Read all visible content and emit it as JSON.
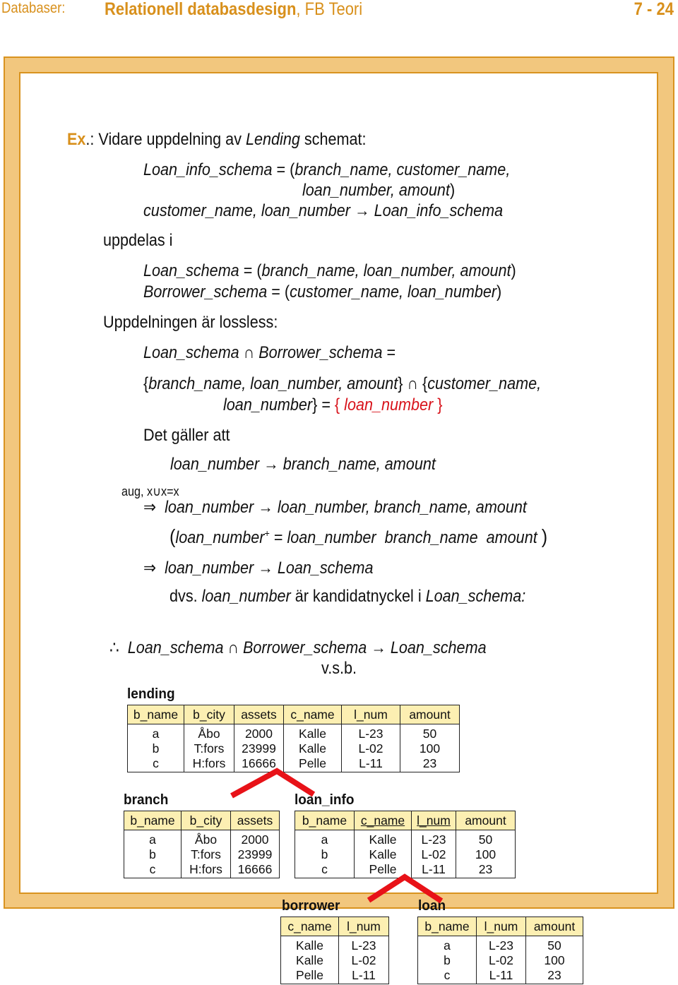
{
  "header": {
    "course": "Databaser:",
    "title_bold": "Relationell databasdesign",
    "title_rest": ", FB Teori",
    "page": "7 - 24"
  },
  "colors": {
    "accent": "#d8901c",
    "frame_fill": "#f2c77e",
    "highlight_red": "#d8131b",
    "table_header": "#fcefb2"
  },
  "content": {
    "ex_label": "Ex",
    "ex_rest_pre": ".: Vidare uppdelning av ",
    "ex_rest_it": "Lending",
    "ex_rest_post": " schemat:",
    "line1a": "Loan_info_schema",
    "line1b": " = (",
    "line1c": "branch_name, customer_name,",
    "line2": "loan_number, amount",
    "line2_close": ")",
    "line3a": "customer_name, loan_number",
    "arrow": "→",
    "line3b": "Loan_info_schema",
    "uppdelas": "uppdelas i",
    "loan_schema_a": "Loan_schema",
    "loan_schema_b": " = (",
    "loan_schema_c": "branch_name, loan_number, amount",
    "close_paren": ")",
    "borrower_schema_a": "Borrower_schema",
    "borrower_schema_b": " = (",
    "borrower_schema_c": "customer_name, loan_number",
    "lossless": "Uppdelningen är lossless:",
    "inter_a": "Loan_schema",
    "cap": "∩",
    "inter_b": "Borrower_schema",
    "equals": " =",
    "set1_open": "{",
    "set1": "branch_name, loan_number, amount",
    "set1_close": "}",
    "set2_open": "{",
    "set2": "customer_name,",
    "set2b": "loan_number",
    "set2_close": "} = ",
    "result_open": "{ ",
    "result": "loan_number",
    "result_close": " }",
    "det_galler": "Det gäller att",
    "fd1a": "loan_number",
    "fd1b": "branch_name, amount",
    "aug": "aug, x∪x=x",
    "implies": "⇒",
    "fd2a": "loan_number",
    "fd2b": "loan_number, branch_name, amount",
    "paren_open": "(",
    "closure_a": "loan_number",
    "closure_sup": "+",
    "closure_b": " = ",
    "closure_c": "loan_number  branch_name  amount",
    "paren_close": ")",
    "fd3a": "loan_number",
    "fd3b": "Loan_schema",
    "dvs_pre": "dvs. ",
    "dvs_it": "loan_number",
    "dvs_mid": " är kandidatnyckel i ",
    "dvs_it2": "Loan_schema:",
    "therefore": "∴",
    "concl_a": "Loan_schema",
    "concl_b": "Borrower_schema",
    "concl_c": "Loan_schema",
    "vsb": "v.s.b."
  },
  "tables": {
    "lending": {
      "name": "lending",
      "columns": [
        "b_name",
        "b_city",
        "assets",
        "c_name",
        "l_num",
        "amount"
      ],
      "rows": [
        [
          "a",
          "Åbo",
          "2000",
          "Kalle",
          "L-23",
          "50"
        ],
        [
          "b",
          "T:fors",
          "23999",
          "Kalle",
          "L-02",
          "100"
        ],
        [
          "c",
          "H:fors",
          "16666",
          "Pelle",
          "L-11",
          "23"
        ]
      ]
    },
    "branch": {
      "name": "branch",
      "columns": [
        "b_name",
        "b_city",
        "assets"
      ],
      "rows": [
        [
          "a",
          "Åbo",
          "2000"
        ],
        [
          "b",
          "T:fors",
          "23999"
        ],
        [
          "c",
          "H:fors",
          "16666"
        ]
      ]
    },
    "loan_info": {
      "name": "loan_info",
      "columns": [
        "b_name",
        "c_name",
        "l_num",
        "amount"
      ],
      "underlined_columns": [
        "c_name",
        "l_num"
      ],
      "rows": [
        [
          "a",
          "Kalle",
          "L-23",
          "50"
        ],
        [
          "b",
          "Kalle",
          "L-02",
          "100"
        ],
        [
          "c",
          "Pelle",
          "L-11",
          "23"
        ]
      ]
    },
    "borrower": {
      "name": "borrower",
      "columns": [
        "c_name",
        "l_num"
      ],
      "rows": [
        [
          "Kalle",
          "L-23"
        ],
        [
          "Kalle",
          "L-02"
        ],
        [
          "Pelle",
          "L-11"
        ]
      ]
    },
    "loan": {
      "name": "loan",
      "columns": [
        "b_name",
        "l_num",
        "amount"
      ],
      "rows": [
        [
          "a",
          "L-23",
          "50"
        ],
        [
          "b",
          "L-02",
          "100"
        ],
        [
          "c",
          "L-11",
          "23"
        ]
      ]
    }
  }
}
